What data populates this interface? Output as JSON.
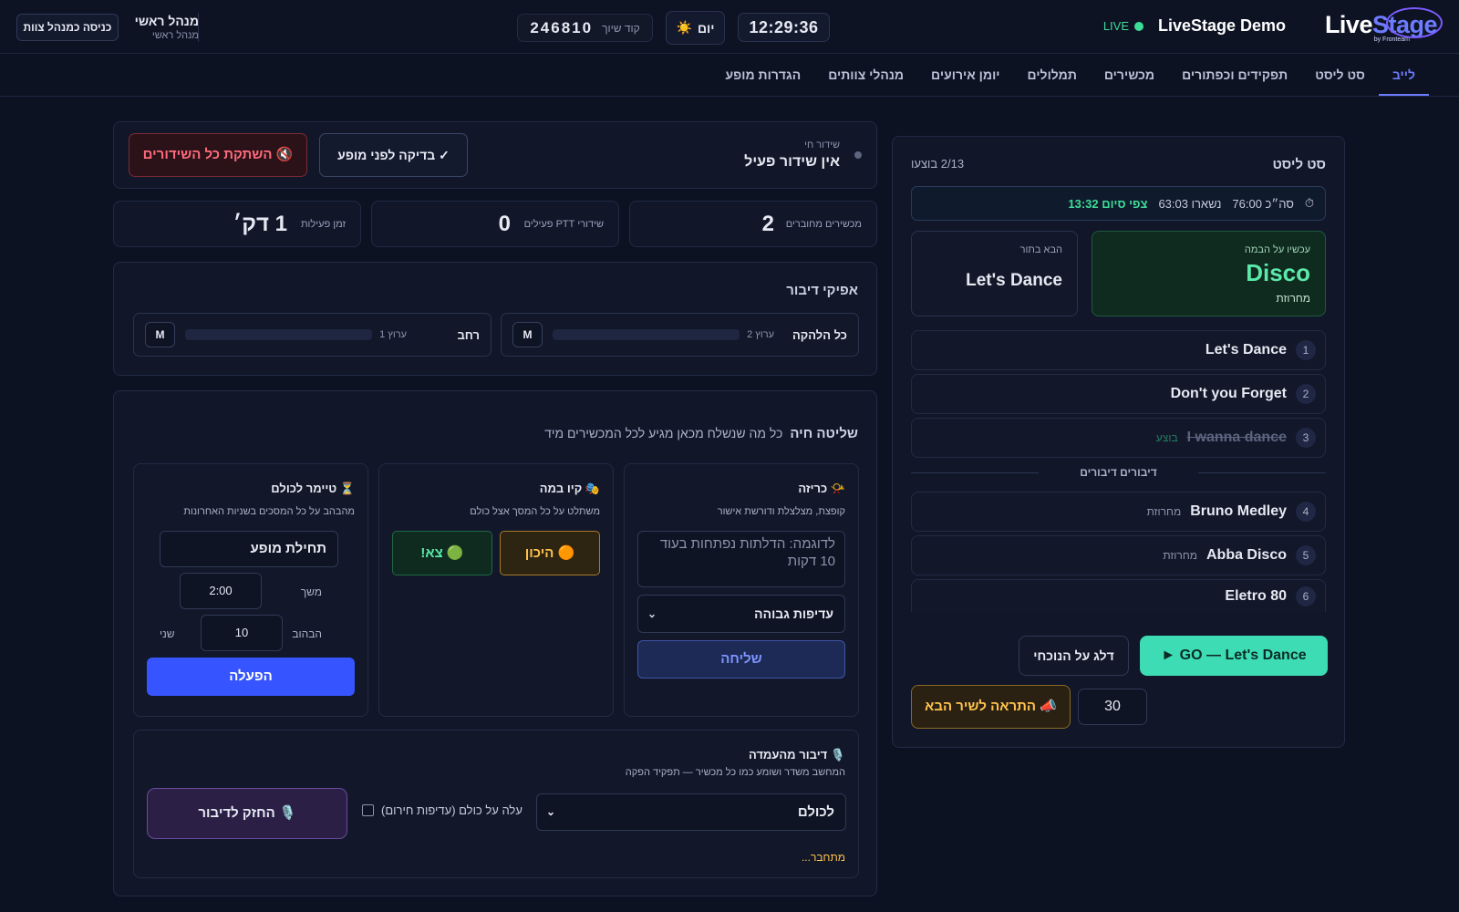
{
  "header": {
    "logo_text_a": "Live",
    "logo_text_b": "Stage",
    "logo_sub": "by Fronteam",
    "title": "LiveStage Demo",
    "live_label": "LIVE",
    "clock": "12:29:36",
    "day_label": "יום",
    "day_icon": "☀️",
    "pair_label": "קוד שיוך",
    "pair_code": "246810",
    "admin_name": "מנהל ראשי",
    "admin_role": "מנהל ראשי",
    "enter_button": "כניסה כמנהל צוות"
  },
  "nav": {
    "tabs": [
      {
        "label": "לייב",
        "active": true
      },
      {
        "label": "סט ליסט"
      },
      {
        "label": "תפקידים וכפתורים"
      },
      {
        "label": "מכשירים"
      },
      {
        "label": "תמלולים"
      },
      {
        "label": "יומן אירועים"
      },
      {
        "label": "מנהלי צוותים"
      },
      {
        "label": "הגדרות מופע"
      }
    ]
  },
  "setlist": {
    "title": "סט ליסט",
    "count": "2/13 בוצעו",
    "total_label": "סה״כ 76:00",
    "remaining_label": "נשארו 63:03",
    "end_label": "צפי סיום 13:32",
    "now_label": "עכשיו על הבמה",
    "now_song": "Disco",
    "now_genre": "מחרוזת",
    "next_label": "הבא בתור",
    "next_song": "Let's Dance",
    "songs_before": [
      {
        "num": "1",
        "name": "Let's Dance",
        "tag": ""
      },
      {
        "num": "2",
        "name": "Don't you Forget",
        "tag": ""
      },
      {
        "num": "3",
        "name": "I wanna dance",
        "tag": "בוצע",
        "done": true
      }
    ],
    "divider": "דיבורים דיבורים",
    "songs_after": [
      {
        "num": "4",
        "name": "Bruno Medley",
        "tag": "מחרוזת"
      },
      {
        "num": "5",
        "name": "Abba Disco",
        "tag": "מחרוזת"
      },
      {
        "num": "6",
        "name": "Eletro 80",
        "tag": ""
      }
    ],
    "go_button": "GO — Let's Dance ►",
    "skip_button": "דלג על הנוכחי",
    "warn_button": "📣 התראה לשיר הבא",
    "warn_seconds": "30"
  },
  "broadcast": {
    "label": "שידור חי",
    "status": "אין שידור פעיל",
    "check_button": "✓ בדיקה לפני מופע",
    "mute_button": "🔇 השתקת כל השידורים"
  },
  "stats": {
    "devices_label": "מכשירים מחוברים",
    "devices_value": "2",
    "ptt_label": "שידורי PTT פעילים",
    "ptt_value": "0",
    "uptime_label": "זמן פעילות",
    "uptime_value": "1 דק׳"
  },
  "speakers": {
    "title": "אפיקי דיבור",
    "channels": [
      {
        "name": "כל הלהקה",
        "channel": "ערוץ 2",
        "mute": "M"
      },
      {
        "name": "רחב",
        "channel": "ערוץ 1",
        "mute": "M"
      }
    ]
  },
  "control": {
    "title": "שליטה חיה",
    "subtitle": "כל מה שנשלח מכאן מגיע לכל המכשירים מיד",
    "announce": {
      "title": "📯 כריזה",
      "desc": "קופצת, מצלצלת ודורשת אישור",
      "placeholder": "לדוגמה: הדלתות נפתחות בעוד 10 דקות",
      "priority": "עדיפות גבוהה",
      "send": "שליחה"
    },
    "cue": {
      "title": "🎭 קיו במה",
      "desc": "משתלט על כל המסך אצל כולם",
      "ready": "🟠 היכון",
      "go": "🟢 צא!"
    },
    "timer": {
      "title": "⏳ טיימר לכולם",
      "desc": "מהבהב על כל המסכים בשניות האחרונות",
      "name": "תחילת מופע",
      "duration_label": "משך",
      "duration": "2:00",
      "blink_label": "הבהוב",
      "blink": "10",
      "blink_unit": "שני",
      "start": "הפעלה"
    },
    "podium": {
      "title": "🎙️ דיבור מהעמדה",
      "desc": "המחשב משדר ושומע כמו כל מכשיר — תפקיד הפקה",
      "target": "לכולם",
      "override": "עלה על כולם (עדיפות חירום)",
      "ptt": "🎙️ החזק לדיבור",
      "status": "מתחבר..."
    }
  }
}
